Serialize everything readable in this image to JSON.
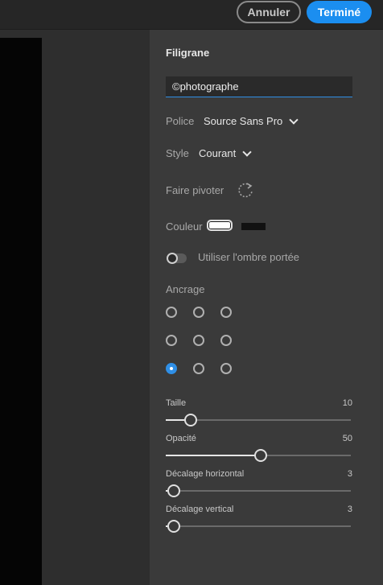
{
  "topbar": {
    "cancel_label": "Annuler",
    "done_label": "Terminé"
  },
  "panel": {
    "title": "Filigrane",
    "watermark_text": "©photographe",
    "font": {
      "label": "Police",
      "value": "Source Sans Pro"
    },
    "style": {
      "label": "Style",
      "value": "Courant"
    },
    "rotate": {
      "label": "Faire pivoter",
      "icon": "rotate-icon"
    },
    "color": {
      "label": "Couleur",
      "colors": [
        "#ffffff",
        "#111111"
      ]
    },
    "shadow": {
      "label": "Utiliser l'ombre portée",
      "enabled": false
    },
    "anchor": {
      "label": "Ancrage",
      "grid": [
        "top-left",
        "top-center",
        "top-right",
        "middle-left",
        "middle-center",
        "middle-right",
        "bottom-left",
        "bottom-center",
        "bottom-right"
      ],
      "selected": "bottom-left"
    },
    "sliders": [
      {
        "label": "Taille",
        "value": "10",
        "fraction": 0.12
      },
      {
        "label": "Opacité",
        "value": "50",
        "fraction": 0.5
      },
      {
        "label": "Décalage horizontal",
        "value": "3",
        "fraction": 0.03
      },
      {
        "label": "Décalage vertical",
        "value": "3",
        "fraction": 0.03
      }
    ]
  },
  "colors": {
    "accent": "#1b8ef0",
    "panel_bg": "#3a3a3a"
  }
}
